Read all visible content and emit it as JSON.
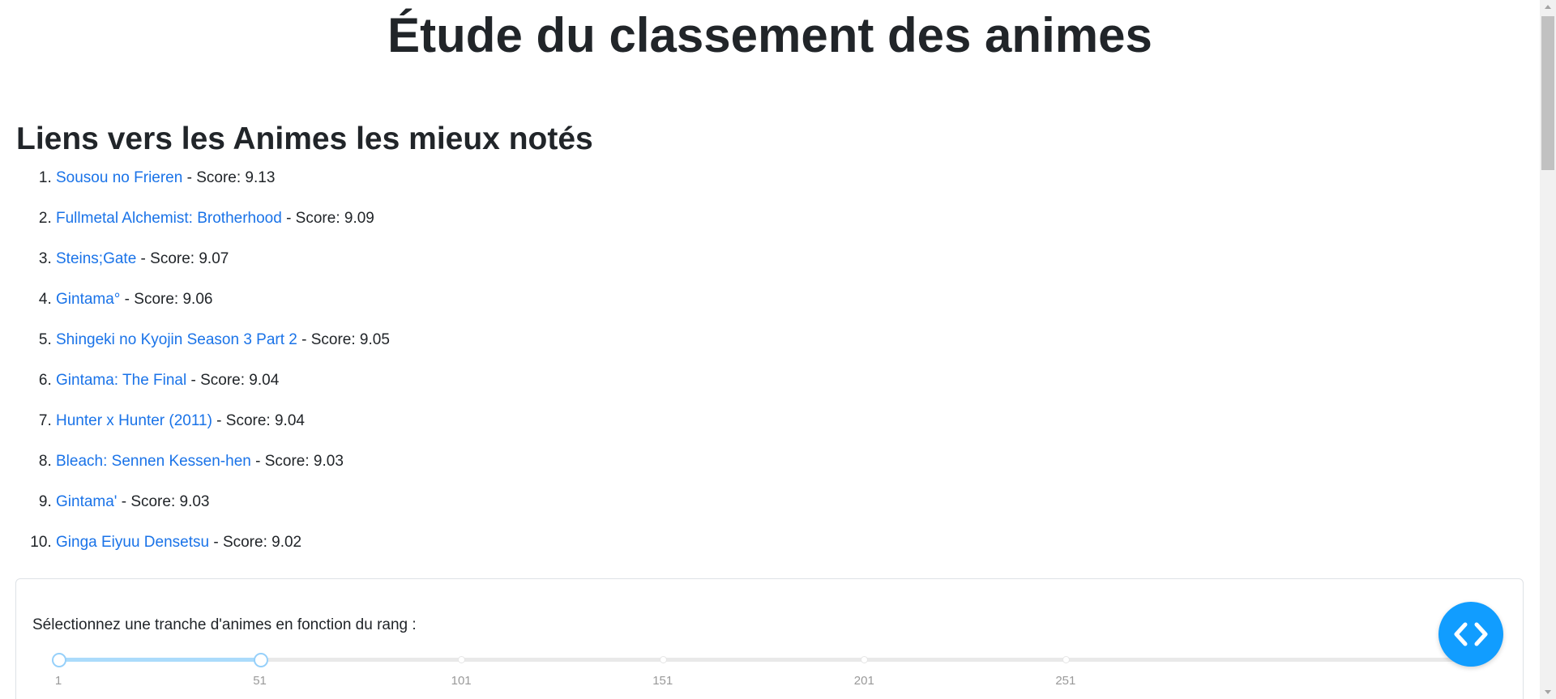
{
  "page": {
    "title": "Étude du classement des animes",
    "section_title": "Liens vers les Animes les mieux notés"
  },
  "top_animes": [
    {
      "name": "Sousou no Frieren",
      "score_text": " - Score: 9.13"
    },
    {
      "name": "Fullmetal Alchemist: Brotherhood",
      "score_text": " - Score: 9.09"
    },
    {
      "name": "Steins;Gate",
      "score_text": " - Score: 9.07"
    },
    {
      "name": "Gintama°",
      "score_text": " - Score: 9.06"
    },
    {
      "name": "Shingeki no Kyojin Season 3 Part 2",
      "score_text": " - Score: 9.05"
    },
    {
      "name": "Gintama: The Final",
      "score_text": " - Score: 9.04"
    },
    {
      "name": "Hunter x Hunter (2011)",
      "score_text": " - Score: 9.04"
    },
    {
      "name": "Bleach: Sennen Kessen-hen",
      "score_text": " - Score: 9.03"
    },
    {
      "name": "Gintama'",
      "score_text": " - Score: 9.03"
    },
    {
      "name": "Ginga Eiyuu Densetsu",
      "score_text": " - Score: 9.02"
    }
  ],
  "range_slider": {
    "label": "Sélectionnez une tranche d'animes en fonction du rang :",
    "marks": [
      "1",
      "51",
      "101",
      "151",
      "201",
      "251"
    ],
    "min": 1,
    "max": 351,
    "value": [
      1,
      51
    ]
  },
  "colors": {
    "link": "#1a73e8",
    "slider_track": "#abdbfb",
    "fab": "#119dff"
  },
  "icons": {
    "fab": "code-brackets-icon"
  }
}
